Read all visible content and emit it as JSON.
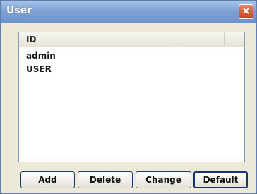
{
  "window": {
    "title": "User",
    "close_glyph": "×"
  },
  "list": {
    "column_header": "ID",
    "rows": [
      "admin",
      "USER"
    ]
  },
  "buttons": {
    "add": "Add",
    "delete": "Delete",
    "change": "Change",
    "default": "Default"
  }
}
